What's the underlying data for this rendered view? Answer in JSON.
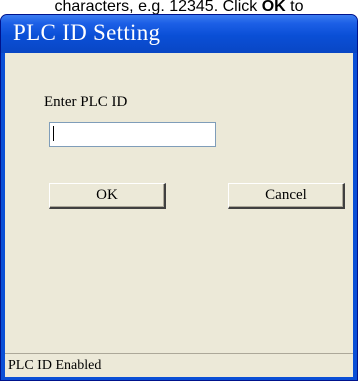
{
  "caption": {
    "before": "characters, e.g. 12345. Click ",
    "bold": "OK",
    "after": " to"
  },
  "dialog": {
    "title": "PLC ID Setting",
    "prompt_label": "Enter PLC ID",
    "id_input": {
      "value": "",
      "placeholder": ""
    },
    "ok_label": "OK",
    "cancel_label": "Cancel",
    "status_text": "PLC ID Enabled"
  },
  "colors": {
    "title_bar": "#0a4fd6",
    "dialog_face": "#ece9d8",
    "input_border": "#7f9db9"
  }
}
